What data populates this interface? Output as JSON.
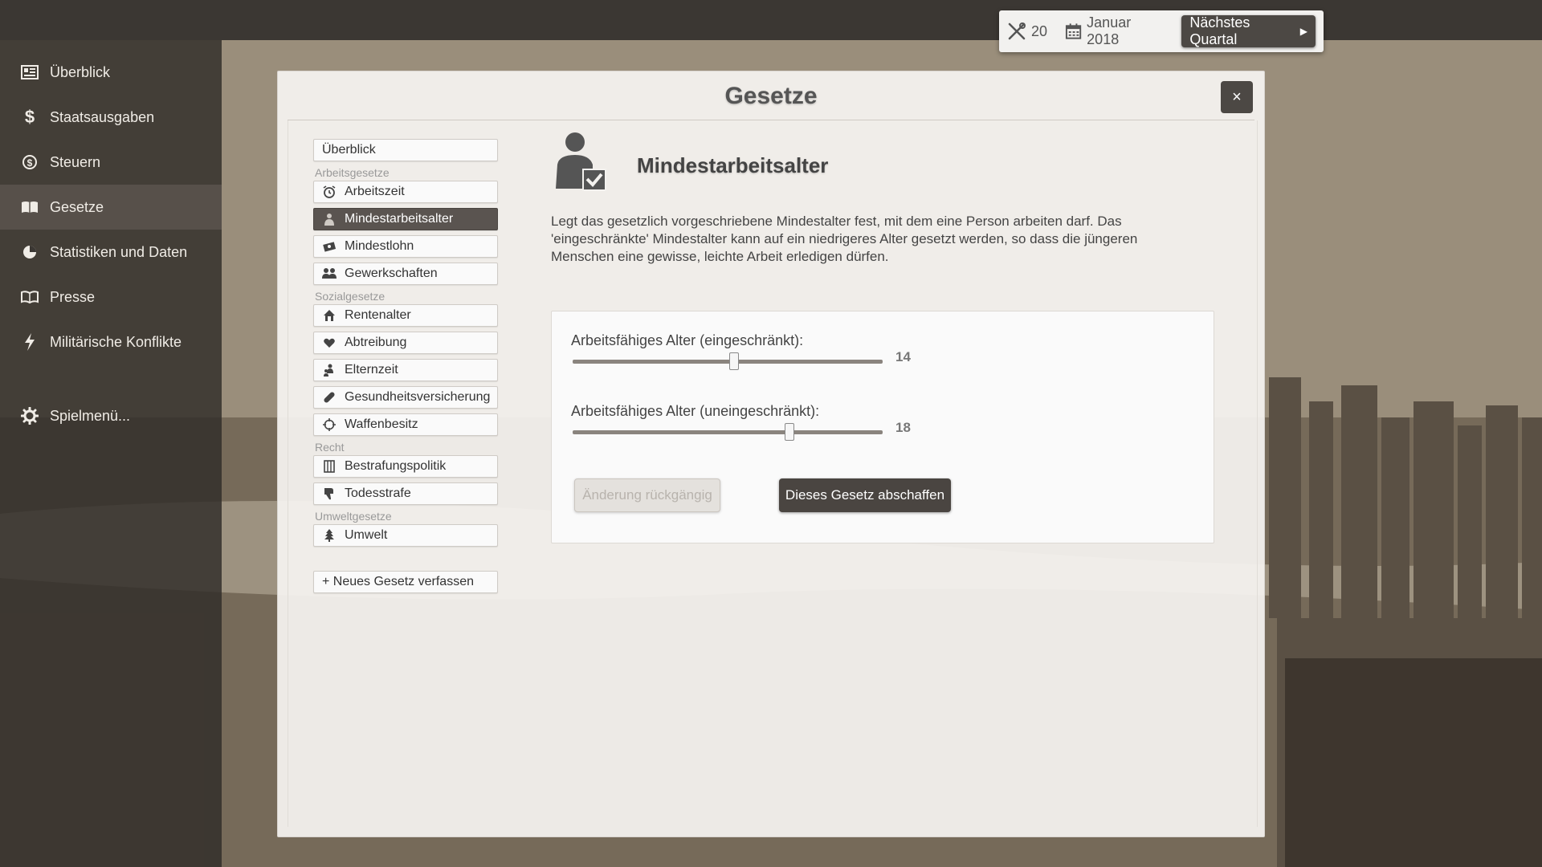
{
  "topbar": {
    "tools_count": "20",
    "date": "Januar 2018",
    "next_quarter_label": "Nächstes Quartal"
  },
  "sidebar": {
    "items": [
      {
        "label": "Überblick",
        "icon": "newspaper-icon"
      },
      {
        "label": "Staatsausgaben",
        "icon": "dollar-icon"
      },
      {
        "label": "Steuern",
        "icon": "coin-icon"
      },
      {
        "label": "Gesetze",
        "icon": "law-book-icon",
        "active": true
      },
      {
        "label": "Statistiken und Daten",
        "icon": "pie-chart-icon"
      },
      {
        "label": "Presse",
        "icon": "open-book-icon"
      },
      {
        "label": "Militärische Konflikte",
        "icon": "lightning-icon"
      }
    ],
    "game_menu": {
      "label": "Spielmenü...",
      "icon": "gear-icon"
    }
  },
  "dialog": {
    "title": "Gesetze",
    "close_label": "×",
    "nav": {
      "overview": "Überblick",
      "groups": [
        {
          "title": "Arbeitsgesetze",
          "items": [
            "Arbeitszeit",
            "Mindestarbeitsalter",
            "Mindestlohn",
            "Gewerkschaften"
          ]
        },
        {
          "title": "Sozialgesetze",
          "items": [
            "Rentenalter",
            "Abtreibung",
            "Elternzeit",
            "Gesundheitsversicherung",
            "Waffenbesitz"
          ]
        },
        {
          "title": "Recht",
          "items": [
            "Bestrafungspolitik",
            "Todesstrafe"
          ]
        },
        {
          "title": "Umweltgesetze",
          "items": [
            "Umwelt"
          ]
        }
      ],
      "new_law": "+ Neues Gesetz verfassen",
      "active_item": "Mindestarbeitsalter"
    },
    "law": {
      "title": "Mindestarbeitsalter",
      "description": "Legt das gesetzlich vorgeschriebene Mindestalter fest, mit dem eine Person arbeiten darf. Das 'eingeschränkte' Mindestalter kann auf ein niedrigeres Alter gesetzt werden, so dass die jüngeren Menschen eine gewisse, leichte Arbeit erledigen dürfen.",
      "sliders": [
        {
          "label": "Arbeitsfähiges Alter (eingeschränkt):",
          "value": "14",
          "fraction": 0.52
        },
        {
          "label": "Arbeitsfähiges Alter (uneingeschränkt):",
          "value": "18",
          "fraction": 0.7
        }
      ],
      "undo_label": "Änderung rückgängig",
      "abolish_label": "Dieses Gesetz abschaffen"
    }
  }
}
